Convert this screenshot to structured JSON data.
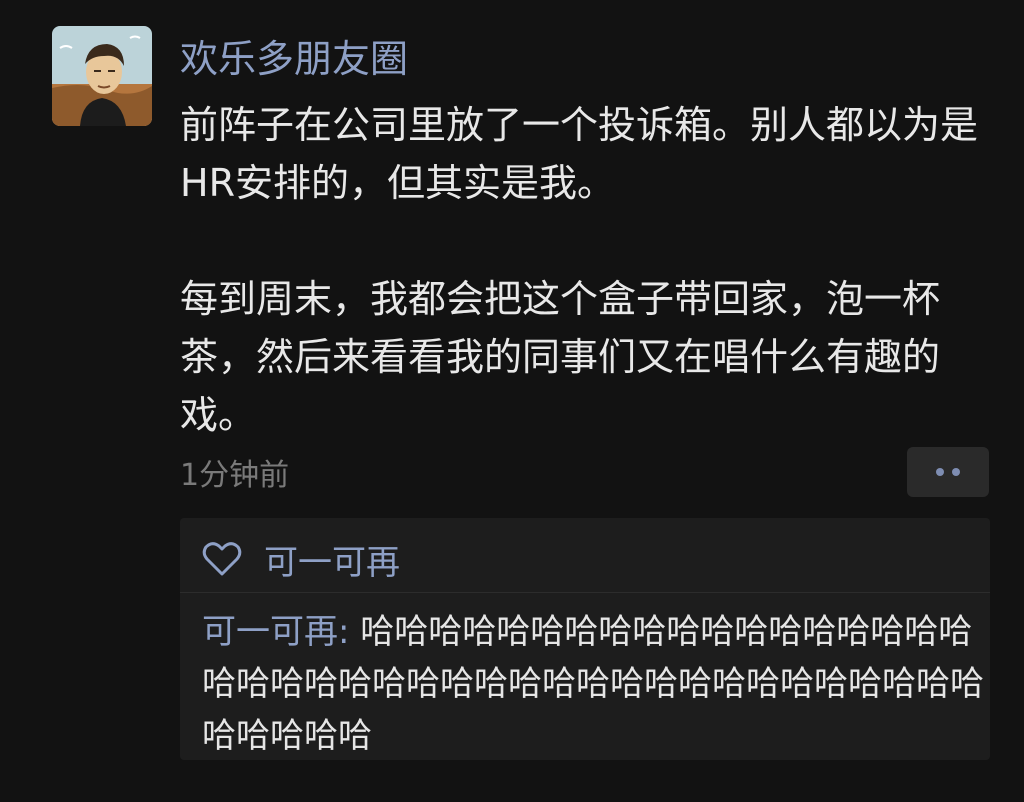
{
  "post": {
    "author_name": "欢乐多朋友圈",
    "paragraphs": [
      "前阵子在公司里放了一个投诉箱。别人都以为是HR安排的，但其实是我。",
      "每到周末，我都会把这个盒子带回家，泡一杯茶，然后来看看我的同事们又在唱什么有趣的戏。"
    ],
    "time": "1分钟前",
    "avatar_icon": "cartoon-man-avatar",
    "more_icon": "two-dots-icon"
  },
  "interactions": {
    "like_icon": "heart-outline-icon",
    "liker_name": "可一可再",
    "comment": {
      "author": "可一可再",
      "separator": ": ",
      "text": "哈哈哈哈哈哈哈哈哈哈哈哈哈哈哈哈哈哈哈哈哈哈哈哈哈哈哈哈哈哈哈哈哈哈哈哈哈哈哈哈哈哈哈哈哈哈"
    }
  },
  "colors": {
    "background": "#121212",
    "name_blue": "#8ea0c6",
    "panel": "#1d1d1d"
  }
}
